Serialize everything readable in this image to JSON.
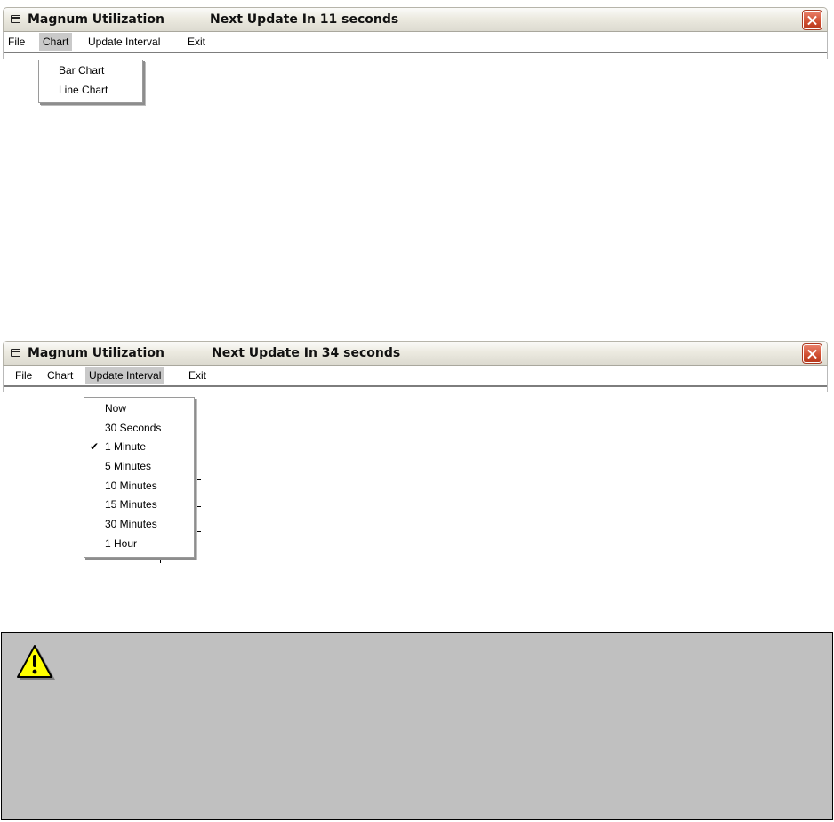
{
  "window1": {
    "title": "Magnum Utilization",
    "update_text": "Next Update In 11 seconds",
    "menu": {
      "items": [
        "File",
        "Chart",
        "Update Interval",
        "Exit"
      ],
      "active": "Chart"
    },
    "dropdown": {
      "items": [
        "Bar Chart",
        "Line Chart"
      ]
    }
  },
  "window2": {
    "title": "Magnum Utilization",
    "update_text": "Next Update In 34 seconds",
    "menu": {
      "items": [
        "File",
        "Chart",
        "Update Interval",
        "Exit"
      ],
      "active": "Update Interval"
    },
    "dropdown": {
      "items": [
        "Now",
        "30 Seconds",
        "1 Minute",
        "5 Minutes",
        "10 Minutes",
        "15 Minutes",
        "30 Minutes",
        "1 Hour"
      ],
      "checked": "1 Minute"
    }
  },
  "warning": {
    "icon": "warning-icon",
    "background": "#c0c0c0"
  },
  "colors": {
    "titlebar": "#eceae0",
    "close_button": "#cf4d2f",
    "menu_highlight": "#c9c9c9"
  }
}
